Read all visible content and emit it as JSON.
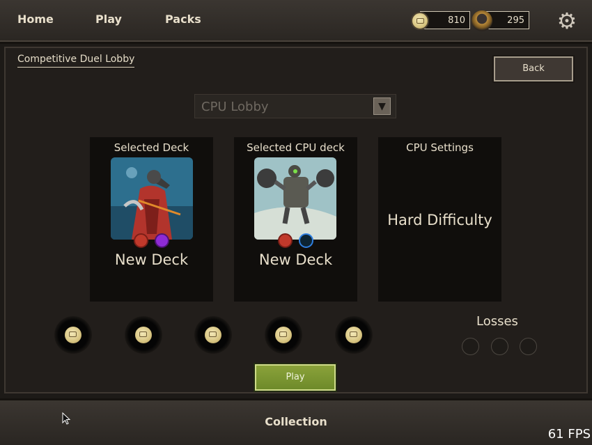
{
  "nav": {
    "home": "Home",
    "play": "Play",
    "packs": "Packs"
  },
  "currency": {
    "gold": "810",
    "dust": "295"
  },
  "lobby": {
    "title": "Competitive Duel Lobby",
    "back_label": "Back",
    "mode_select": "CPU Lobby"
  },
  "cards": {
    "player": {
      "header": "Selected Deck",
      "deck_name": "New Deck",
      "factions": [
        "red-flame",
        "purple-spiral"
      ]
    },
    "cpu": {
      "header": "Selected CPU deck",
      "deck_name": "New Deck",
      "factions": [
        "red-flame",
        "blue-shield"
      ]
    },
    "settings": {
      "header": "CPU Settings",
      "difficulty": "Hard Difficulty"
    }
  },
  "wins_slots": 5,
  "losses": {
    "label": "Losses",
    "count_slots": 3
  },
  "play_label": "Play",
  "bottom": {
    "collection_label": "Collection"
  },
  "fps": "61 FPS",
  "colors": {
    "play_green": "#7a9530",
    "faction_red": "#c0392b",
    "faction_purple": "#8e2bd6",
    "faction_blue": "#2f7fe0"
  }
}
